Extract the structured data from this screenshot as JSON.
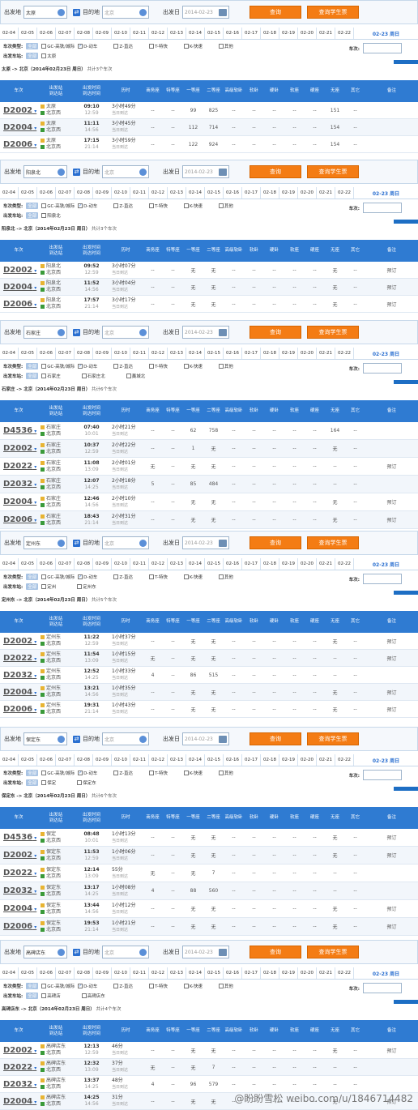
{
  "labels": {
    "from": "出发地",
    "to": "目的地",
    "date": "出发日",
    "search": "查询",
    "student": "查询学生票",
    "types": "车次类型:",
    "all": "全部",
    "gc": "GC-高铁/城际",
    "d": "D-动车",
    "z": "Z-直达",
    "t": "T-特快",
    "k": "K-快速",
    "other": "其他",
    "trainno": "车次:",
    "station": "出发车站:",
    "dest": "北京",
    "date_val": "2014-02-23",
    "cur_date": "02-23 周日"
  },
  "dates": [
    "02-04",
    "02-05",
    "02-06",
    "02-07",
    "02-08",
    "02-09",
    "02-10",
    "02-11",
    "02-12",
    "02-13",
    "02-14",
    "02-15",
    "02-16",
    "02-17",
    "02-18",
    "02-19",
    "02-20",
    "02-21",
    "02-22"
  ],
  "headers": [
    "车次",
    "出发站\n到达站",
    "出发时间\n到达时间",
    "历时",
    "商务座",
    "特等座",
    "一等座",
    "二等座",
    "高级软卧",
    "软卧",
    "硬卧",
    "软座",
    "硬座",
    "无座",
    "其它",
    "备注"
  ],
  "sections": [
    {
      "from": "太原",
      "route": "太原 -> 北京（2014年02月23日  周日）",
      "count": "共计3个车次",
      "stations": [
        "太原"
      ],
      "rows": [
        {
          "no": "D2002",
          "s1": "太原",
          "s2": "北京西",
          "t1": "09:10",
          "t2": "12:59",
          "d1": "3小时49分",
          "d2": "当日到达",
          "v": [
            "--",
            "--",
            "99",
            "825",
            "--",
            "--",
            "--",
            "--",
            "--",
            "151",
            "--"
          ],
          "note": ""
        },
        {
          "no": "D2004",
          "s1": "太原",
          "s2": "北京西",
          "t1": "11:11",
          "t2": "14:56",
          "d1": "3小时45分",
          "d2": "当日到达",
          "v": [
            "--",
            "--",
            "112",
            "714",
            "--",
            "--",
            "--",
            "--",
            "--",
            "154",
            "--"
          ],
          "note": ""
        },
        {
          "no": "D2006",
          "s1": "太原",
          "s2": "北京西",
          "t1": "17:15",
          "t2": "21:14",
          "d1": "3小时59分",
          "d2": "当日到达",
          "v": [
            "--",
            "--",
            "122",
            "924",
            "--",
            "--",
            "--",
            "--",
            "--",
            "154",
            "--"
          ],
          "note": ""
        }
      ]
    },
    {
      "from": "阳泉北",
      "route": "阳泉北 -> 北京（2014年02月23日  周日）",
      "count": "共计3个车次",
      "stations": [
        "阳泉北"
      ],
      "rows": [
        {
          "no": "D2002",
          "s1": "阳泉北",
          "s2": "北京西",
          "t1": "09:52",
          "t2": "12:59",
          "d1": "3小时07分",
          "d2": "当日到达",
          "v": [
            "--",
            "--",
            "无",
            "无",
            "--",
            "--",
            "--",
            "--",
            "--",
            "无",
            "--"
          ],
          "note": "预订"
        },
        {
          "no": "D2004",
          "s1": "阳泉北",
          "s2": "北京西",
          "t1": "11:52",
          "t2": "14:56",
          "d1": "3小时04分",
          "d2": "当日到达",
          "v": [
            "--",
            "--",
            "无",
            "无",
            "--",
            "--",
            "--",
            "--",
            "--",
            "无",
            "--"
          ],
          "note": "预订"
        },
        {
          "no": "D2006",
          "s1": "阳泉北",
          "s2": "北京西",
          "t1": "17:57",
          "t2": "21:14",
          "d1": "3小时17分",
          "d2": "当日到达",
          "v": [
            "--",
            "--",
            "无",
            "无",
            "--",
            "--",
            "--",
            "--",
            "--",
            "无",
            "--"
          ],
          "note": "预订"
        }
      ]
    },
    {
      "from": "石家庄",
      "route": "石家庄 -> 北京（2014年02月23日  周日）",
      "count": "共计6个车次",
      "stations": [
        "石家庄",
        "石家庄北",
        "藁城北"
      ],
      "rows": [
        {
          "no": "D4536",
          "s1": "石家庄",
          "s2": "北京西",
          "t1": "07:40",
          "t2": "10:01",
          "d1": "2小时21分",
          "d2": "当日到达",
          "v": [
            "--",
            "--",
            "62",
            "758",
            "--",
            "--",
            "--",
            "--",
            "--",
            "164",
            "--"
          ],
          "note": ""
        },
        {
          "no": "D2002",
          "s1": "石家庄",
          "s2": "北京西",
          "t1": "10:37",
          "t2": "12:59",
          "d1": "2小时22分",
          "d2": "当日到达",
          "v": [
            "--",
            "--",
            "1",
            "无",
            "--",
            "--",
            "--",
            "--",
            "--",
            "无",
            "--"
          ],
          "note": ""
        },
        {
          "no": "D2022",
          "s1": "石家庄",
          "s2": "北京西",
          "t1": "11:08",
          "t2": "13:09",
          "d1": "2小时01分",
          "d2": "当日到达",
          "v": [
            "无",
            "--",
            "无",
            "无",
            "--",
            "--",
            "--",
            "--",
            "--",
            "--",
            "--"
          ],
          "note": "预订"
        },
        {
          "no": "D2032",
          "s1": "石家庄",
          "s2": "北京西",
          "t1": "12:07",
          "t2": "14:25",
          "d1": "2小时18分",
          "d2": "当日到达",
          "v": [
            "5",
            "--",
            "85",
            "484",
            "--",
            "--",
            "--",
            "--",
            "--",
            "--",
            "--"
          ],
          "note": ""
        },
        {
          "no": "D2004",
          "s1": "石家庄",
          "s2": "北京西",
          "t1": "12:46",
          "t2": "14:56",
          "d1": "2小时10分",
          "d2": "当日到达",
          "v": [
            "--",
            "--",
            "无",
            "无",
            "--",
            "--",
            "--",
            "--",
            "--",
            "无",
            "--"
          ],
          "note": "预订"
        },
        {
          "no": "D2006",
          "s1": "石家庄",
          "s2": "北京西",
          "t1": "18:43",
          "t2": "21:14",
          "d1": "2小时31分",
          "d2": "当日到达",
          "v": [
            "--",
            "--",
            "无",
            "无",
            "--",
            "--",
            "--",
            "--",
            "--",
            "无",
            "--"
          ],
          "note": "预订"
        }
      ]
    },
    {
      "from": "定州东",
      "route": "定州东 -> 北京（2014年02月23日  周日）",
      "count": "共计5个车次",
      "stations": [
        "定州",
        "定州东"
      ],
      "rows": [
        {
          "no": "D2002",
          "s1": "定州东",
          "s2": "北京西",
          "t1": "11:22",
          "t2": "12:59",
          "d1": "1小时37分",
          "d2": "当日到达",
          "v": [
            "--",
            "--",
            "无",
            "无",
            "--",
            "--",
            "--",
            "--",
            "--",
            "无",
            "--"
          ],
          "note": "预订"
        },
        {
          "no": "D2022",
          "s1": "定州东",
          "s2": "北京西",
          "t1": "11:54",
          "t2": "13:09",
          "d1": "1小时15分",
          "d2": "当日到达",
          "v": [
            "无",
            "--",
            "无",
            "无",
            "--",
            "--",
            "--",
            "--",
            "--",
            "--",
            "--"
          ],
          "note": "预订"
        },
        {
          "no": "D2032",
          "s1": "定州东",
          "s2": "北京西",
          "t1": "12:52",
          "t2": "14:25",
          "d1": "1小时33分",
          "d2": "当日到达",
          "v": [
            "4",
            "--",
            "86",
            "515",
            "--",
            "--",
            "--",
            "--",
            "--",
            "--",
            "--"
          ],
          "note": ""
        },
        {
          "no": "D2004",
          "s1": "定州东",
          "s2": "北京西",
          "t1": "13:21",
          "t2": "14:56",
          "d1": "1小时35分",
          "d2": "当日到达",
          "v": [
            "--",
            "--",
            "无",
            "无",
            "--",
            "--",
            "--",
            "--",
            "--",
            "无",
            "--"
          ],
          "note": "预订"
        },
        {
          "no": "D2006",
          "s1": "定州东",
          "s2": "北京西",
          "t1": "19:31",
          "t2": "21:14",
          "d1": "1小时43分",
          "d2": "当日到达",
          "v": [
            "--",
            "--",
            "无",
            "无",
            "--",
            "--",
            "--",
            "--",
            "--",
            "无",
            "--"
          ],
          "note": "预订"
        }
      ]
    },
    {
      "from": "保定东",
      "route": "保定东 -> 北京（2014年02月23日  周日）",
      "count": "共计6个车次",
      "stations": [
        "保定",
        "保定东"
      ],
      "rows": [
        {
          "no": "D4536",
          "s1": "保定",
          "s2": "北京西",
          "t1": "08:48",
          "t2": "10:01",
          "d1": "1小时13分",
          "d2": "当日到达",
          "v": [
            "--",
            "--",
            "无",
            "无",
            "--",
            "--",
            "--",
            "--",
            "--",
            "无",
            "--"
          ],
          "note": "预订"
        },
        {
          "no": "D2002",
          "s1": "保定东",
          "s2": "北京西",
          "t1": "11:53",
          "t2": "12:59",
          "d1": "1小时06分",
          "d2": "当日到达",
          "v": [
            "--",
            "--",
            "无",
            "无",
            "--",
            "--",
            "--",
            "--",
            "--",
            "无",
            "--"
          ],
          "note": "预订"
        },
        {
          "no": "D2022",
          "s1": "保定东",
          "s2": "北京西",
          "t1": "12:14",
          "t2": "13:09",
          "d1": "55分",
          "d2": "当日到达",
          "v": [
            "无",
            "--",
            "无",
            "7",
            "--",
            "--",
            "--",
            "--",
            "--",
            "--",
            "--"
          ],
          "note": ""
        },
        {
          "no": "D2032",
          "s1": "保定东",
          "s2": "北京西",
          "t1": "13:17",
          "t2": "14:25",
          "d1": "1小时08分",
          "d2": "当日到达",
          "v": [
            "4",
            "--",
            "88",
            "560",
            "--",
            "--",
            "--",
            "--",
            "--",
            "--",
            "--"
          ],
          "note": ""
        },
        {
          "no": "D2004",
          "s1": "保定东",
          "s2": "北京西",
          "t1": "13:44",
          "t2": "14:56",
          "d1": "1小时12分",
          "d2": "当日到达",
          "v": [
            "--",
            "--",
            "无",
            "无",
            "--",
            "--",
            "--",
            "--",
            "--",
            "无",
            "--"
          ],
          "note": "预订"
        },
        {
          "no": "D2006",
          "s1": "保定东",
          "s2": "北京西",
          "t1": "19:53",
          "t2": "21:14",
          "d1": "1小时21分",
          "d2": "当日到达",
          "v": [
            "--",
            "--",
            "无",
            "无",
            "--",
            "--",
            "--",
            "--",
            "--",
            "无",
            "--"
          ],
          "note": "预订"
        }
      ]
    },
    {
      "from": "高碑店东",
      "route": "高碑店东 -> 北京（2014年02月23日  周日）",
      "count": "共计4个车次",
      "stations": [
        "高碑店",
        "高碑店东"
      ],
      "rows": [
        {
          "no": "D2002",
          "s1": "高碑店东",
          "s2": "北京西",
          "t1": "12:13",
          "t2": "12:59",
          "d1": "46分",
          "d2": "当日到达",
          "v": [
            "--",
            "--",
            "无",
            "无",
            "--",
            "--",
            "--",
            "--",
            "--",
            "无",
            "--"
          ],
          "note": "预订"
        },
        {
          "no": "D2022",
          "s1": "高碑店东",
          "s2": "北京西",
          "t1": "12:32",
          "t2": "13:09",
          "d1": "37分",
          "d2": "当日到达",
          "v": [
            "无",
            "--",
            "无",
            "7",
            "--",
            "--",
            "--",
            "--",
            "--",
            "--",
            "--"
          ],
          "note": ""
        },
        {
          "no": "D2032",
          "s1": "高碑店东",
          "s2": "北京西",
          "t1": "13:37",
          "t2": "14:25",
          "d1": "48分",
          "d2": "当日到达",
          "v": [
            "4",
            "--",
            "96",
            "579",
            "--",
            "--",
            "--",
            "--",
            "--",
            "--",
            "--"
          ],
          "note": ""
        },
        {
          "no": "D2004",
          "s1": "高碑店东",
          "s2": "北京西",
          "t1": "14:25",
          "t2": "14:56",
          "d1": "31分",
          "d2": "当日到达",
          "v": [
            "--",
            "--",
            "无",
            "无",
            "--",
            "--",
            "--",
            "--",
            "--",
            "无",
            "--"
          ],
          "note": "预订"
        }
      ]
    }
  ],
  "watermark": "@盼盼雪松 weibo.com/u/1846714482"
}
